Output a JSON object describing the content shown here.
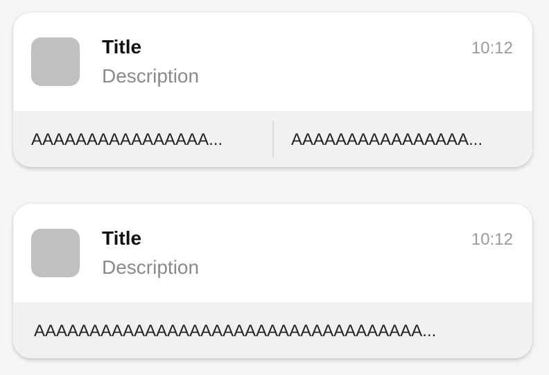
{
  "cards": [
    {
      "title": "Title",
      "description": "Description",
      "time": "10:12",
      "actions": [
        "AAAAAAAAAAAAAAAA...",
        "AAAAAAAAAAAAAAAA..."
      ]
    },
    {
      "title": "Title",
      "description": "Description",
      "time": "10:12",
      "actions": [
        "AAAAAAAAAAAAAAAAAAAAAAAAAAAAAAAAAAA..."
      ]
    }
  ],
  "colors": {
    "page_background": "#f5f5f5",
    "card_background": "#ffffff",
    "action_bar_background": "#f1f1f1",
    "thumbnail": "#c0c0c0",
    "title_text": "#111111",
    "secondary_text": "#8a8a8a"
  }
}
